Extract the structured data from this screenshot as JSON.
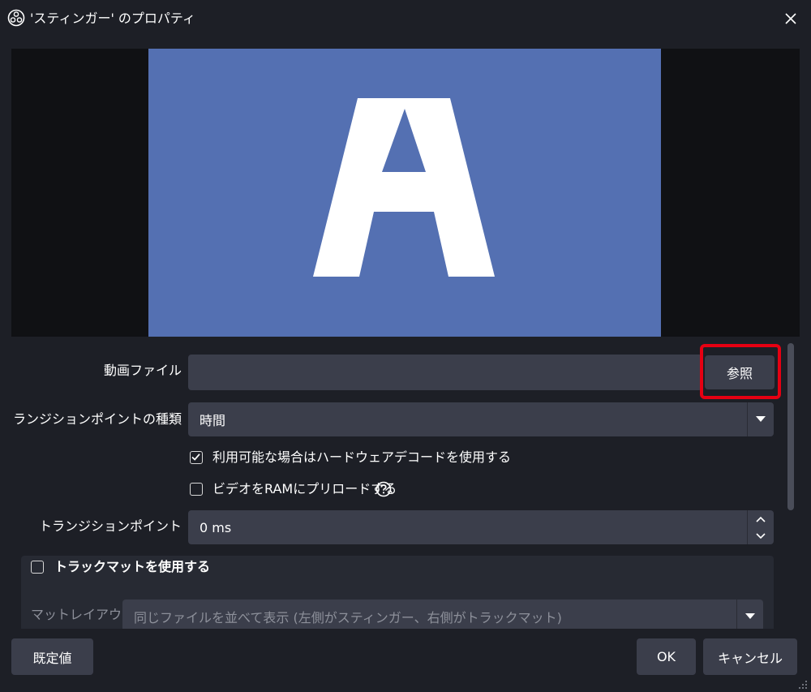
{
  "window": {
    "title": "'スティンガー' のプロパティ",
    "close_icon": "close-icon"
  },
  "preview": {
    "letter": "A",
    "background_color": "#5470b2"
  },
  "form": {
    "video_file": {
      "label": "動画ファイル",
      "value": "",
      "browse_label": "参照"
    },
    "transition_point_type": {
      "label": "トランジションポイントの種類",
      "selected": "時間"
    },
    "hw_decode": {
      "label": "利用可能な場合はハードウェアデコードを使用する",
      "checked": true
    },
    "preload_ram": {
      "label": "ビデオをRAMにプリロードする",
      "checked": false,
      "help_icon": "help-icon"
    },
    "transition_point": {
      "label": "トランジションポイント",
      "value": "0 ms"
    },
    "track_matte": {
      "label": "トラックマットを使用する",
      "checked": false,
      "matte_layout_label": "マットレイアウト",
      "matte_layout_value": "同じファイルを並べて表示 (左側がスティンガー、右側がトラックマット)"
    }
  },
  "footer": {
    "defaults_label": "既定値",
    "ok_label": "OK",
    "cancel_label": "キャンセル"
  },
  "highlight_color": "#e60012"
}
